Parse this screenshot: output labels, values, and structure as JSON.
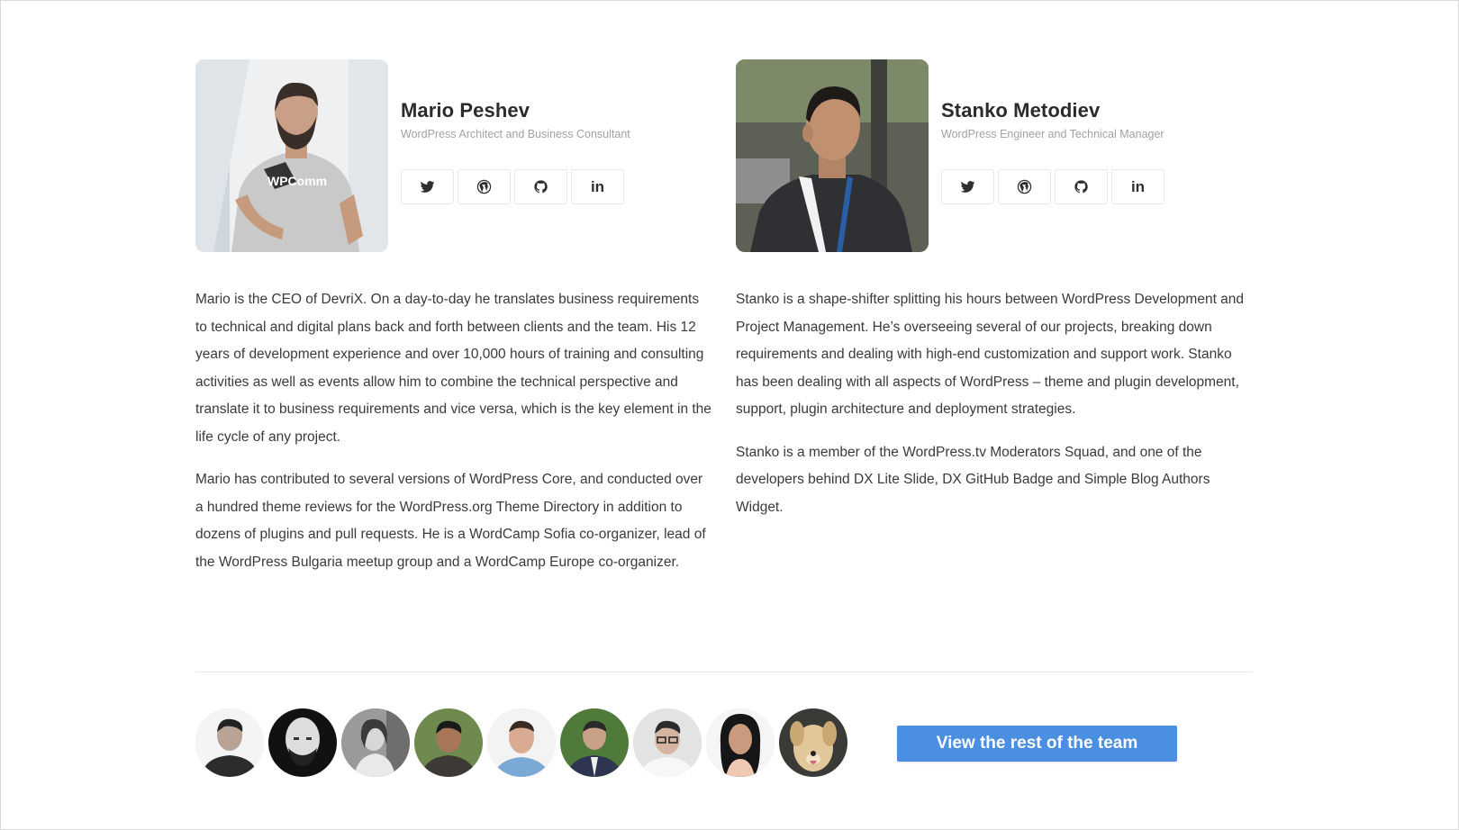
{
  "profiles": [
    {
      "name": "Mario Peshev",
      "role": "WordPress Architect and Business Consultant",
      "bio": [
        "Mario is the CEO of DevriX. On a day-to-day he translates business requirements to technical and digital plans back and forth between clients and the team. His 12 years of development experience and over 10,000 hours of training and consulting activities as well as events allow him to combine the technical perspective and translate it to business requirements and vice versa, which is the key element in the life cycle of any project.",
        "Mario has contributed to several versions of WordPress Core, and conducted over a hundred theme reviews for the WordPress.org Theme Directory in addition to dozens of plugins and pull requests. He is a WordCamp Sofia co-organizer, lead of the WordPress Bulgaria meetup group and a WordCamp Europe co-organizer."
      ],
      "socials": [
        "twitter-icon",
        "wordpress-icon",
        "github-icon",
        "linkedin-icon"
      ],
      "shirt_text": "WPComm"
    },
    {
      "name": "Stanko Metodiev",
      "role": "WordPress Engineer and Technical Manager",
      "bio": [
        "Stanko is a shape-shifter splitting his hours between WordPress Development and Project Management. He’s overseeing several of our projects, breaking down requirements and dealing with high-end customization and support work. Stanko has been dealing with all aspects of WordPress – theme and plugin development, support, plugin architecture and deployment strategies.",
        "Stanko is a member of the WordPress.tv Moderators Squad, and one of the developers behind DX Lite Slide, DX GitHub Badge and Simple Blog Authors Widget."
      ],
      "socials": [
        "twitter-icon",
        "wordpress-icon",
        "github-icon",
        "linkedin-icon"
      ]
    }
  ],
  "team_avatars_count": 9,
  "cta_label": "View the rest of the team",
  "colors": {
    "accent": "#4a8fe2",
    "name_text": "#2b2b2b",
    "role_text": "#a2a2a2",
    "body_text": "#3a3a3a"
  }
}
